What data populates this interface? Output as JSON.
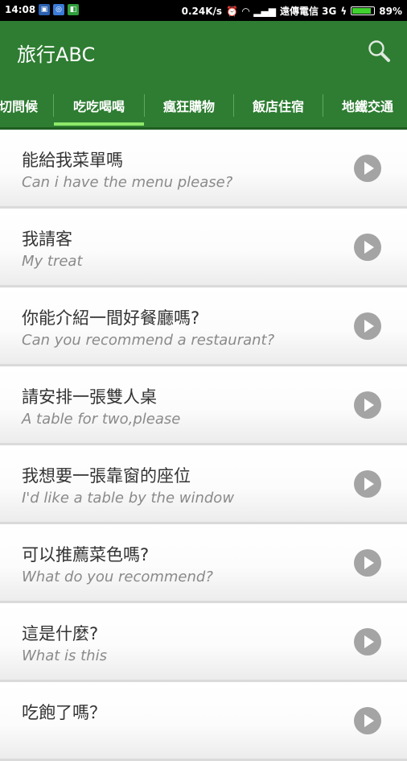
{
  "status": {
    "time": "14:08",
    "speed": "0.24K/s",
    "carrier": "遠傳電信 3G",
    "battery": "89%",
    "battery_level": 0.89
  },
  "app": {
    "title": "旅行ABC"
  },
  "tabs": [
    {
      "label": "切問候"
    },
    {
      "label": "吃吃喝喝"
    },
    {
      "label": "瘋狂購物"
    },
    {
      "label": "飯店住宿"
    },
    {
      "label": "地鐵交通"
    }
  ],
  "active_tab": 1,
  "phrases": [
    {
      "zh": "能給我菜單嗎",
      "en": "Can i have the menu please?"
    },
    {
      "zh": "我請客",
      "en": "My treat"
    },
    {
      "zh": "你能介紹一間好餐廳嗎?",
      "en": "Can you recommend a restaurant?"
    },
    {
      "zh": "請安排一張雙人桌",
      "en": "A table for two,please"
    },
    {
      "zh": "我想要一張靠窗的座位",
      "en": "I'd like a table by the window"
    },
    {
      "zh": "可以推薦菜色嗎?",
      "en": "What do you recommend?"
    },
    {
      "zh": "這是什麼?",
      "en": "What is this"
    },
    {
      "zh": "吃飽了嗎？",
      "en": ""
    }
  ],
  "colors": {
    "primary": "#2e7d32",
    "indicator": "#8ee86a",
    "play": "#a4a4a4"
  }
}
